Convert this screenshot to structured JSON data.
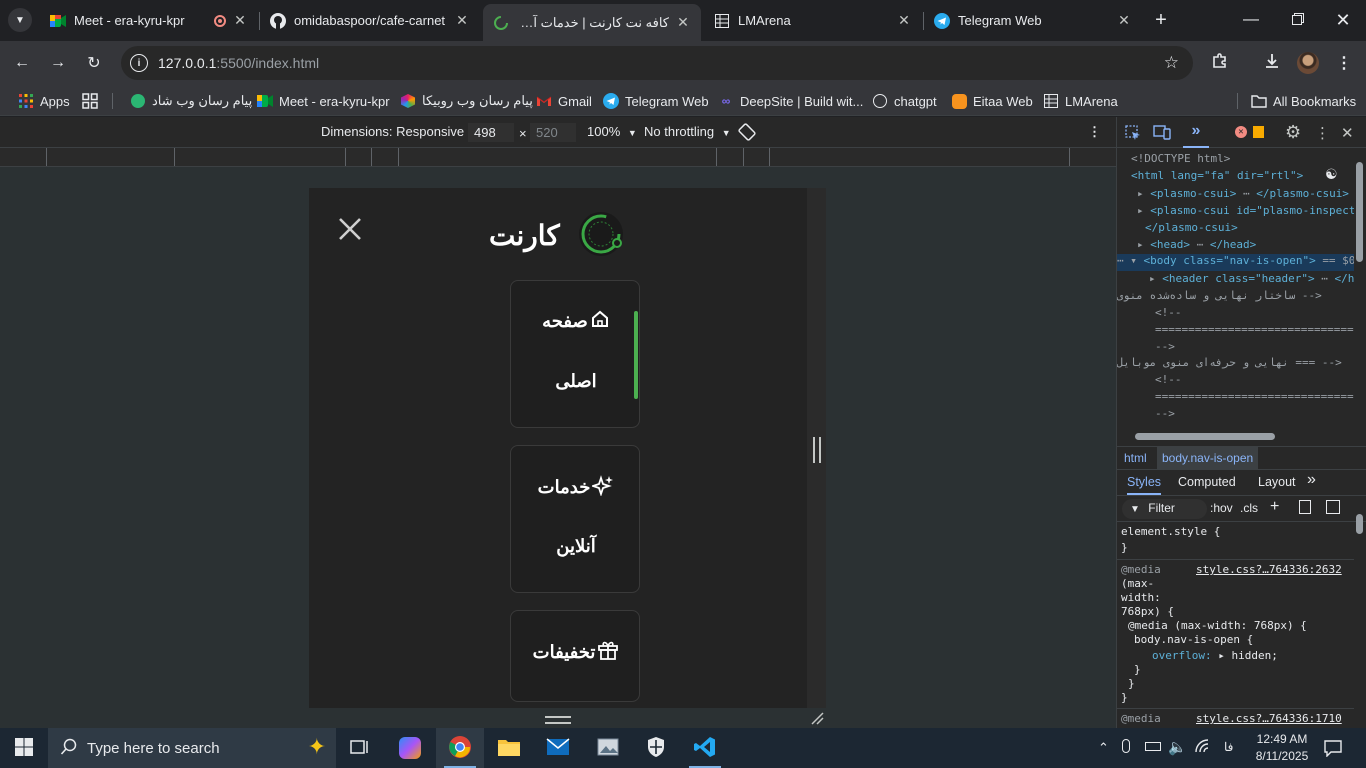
{
  "tabs": [
    {
      "title": "Meet - era-kyru-kpr",
      "favicon": "google-meet-icon"
    },
    {
      "title": "omidabaspoor/cafe-carnet",
      "favicon": "github-icon"
    },
    {
      "title": "کافه نت کارنت | خدمات آنلاین",
      "favicon": "loading-icon"
    },
    {
      "title": "LMArena",
      "favicon": "lmarena-icon"
    },
    {
      "title": "Telegram Web",
      "favicon": "telegram-icon"
    }
  ],
  "address": {
    "host": "127.0.0.1",
    "path": ":5500/index.html"
  },
  "bookmarks": [
    {
      "label": "Apps"
    },
    {
      "label": "پیام رسان وب شاد"
    },
    {
      "label": "Meet - era-kyru-kpr"
    },
    {
      "label": "پیام رسان وب روبیکا"
    },
    {
      "label": "Gmail"
    },
    {
      "label": "Telegram Web"
    },
    {
      "label": "DeepSite | Build wit..."
    },
    {
      "label": "chatgpt"
    },
    {
      "label": "Eitaa Web"
    },
    {
      "label": "LMArena"
    }
  ],
  "all_bookmarks": "All Bookmarks",
  "device_toolbar": {
    "dimensions": "Dimensions: Responsive",
    "width": "498",
    "height": "520",
    "zoom": "100%",
    "throttling": "No throttling"
  },
  "site": {
    "brand": "کارنت",
    "menu": [
      {
        "line1": "صفحه",
        "line2": "اصلی",
        "icon": "home-icon",
        "active": true
      },
      {
        "line1": "خدمات",
        "line2": "آنلاین",
        "icon": "sparkle-icon",
        "active": false
      },
      {
        "line1": "تخفیفات",
        "line2": "",
        "icon": "gift-icon",
        "active": false
      }
    ],
    "accent": "#4caf50"
  },
  "devtools": {
    "dom": [
      "<!DOCTYPE html>",
      "<html lang=\"fa\" dir=\"rtl\">",
      "<plasmo-csui>",
      "</plasmo-csui>",
      "<plasmo-csui id=\"plasmo-inspecto",
      "</plasmo-csui>",
      "<head>",
      "</head>",
      "<body class=\"nav-is-open\">",
      "== $0",
      "<header class=\"header\">",
      "</he",
      "<!-- ساختار نهایی و ساده‌شده منوی موبایل -->",
      "<!--",
      "==============================",
      "-->",
      "<!-- === نهایی و حرفه‌ای منوی موبایل === -->",
      "<!--",
      "==============================",
      "-->"
    ],
    "breadcrumbs": [
      "html",
      "body.nav-is-open"
    ],
    "style_tabs": [
      "Styles",
      "Computed",
      "Layout"
    ],
    "filter_placeholder": "Filter",
    "hov": ":hov",
    "cls": ".cls",
    "styles": {
      "element_style": "element.style {",
      "close": "}",
      "media_at": "@media",
      "media_cond_1": "(max-",
      "media_cond_2": "width:",
      "media_cond_3": "768px) {",
      "source1": "style.css?…764336:2632",
      "inner_media": "@media (max-width: 768px) {",
      "selector": "body.nav-is-open {",
      "prop": "overflow:",
      "value": "hidden;",
      "source2": "style.css?…764336:1710"
    }
  },
  "taskbar": {
    "search_placeholder": "Type here to search",
    "time": "12:49 AM",
    "date": "8/11/2025",
    "lang": "فا"
  }
}
